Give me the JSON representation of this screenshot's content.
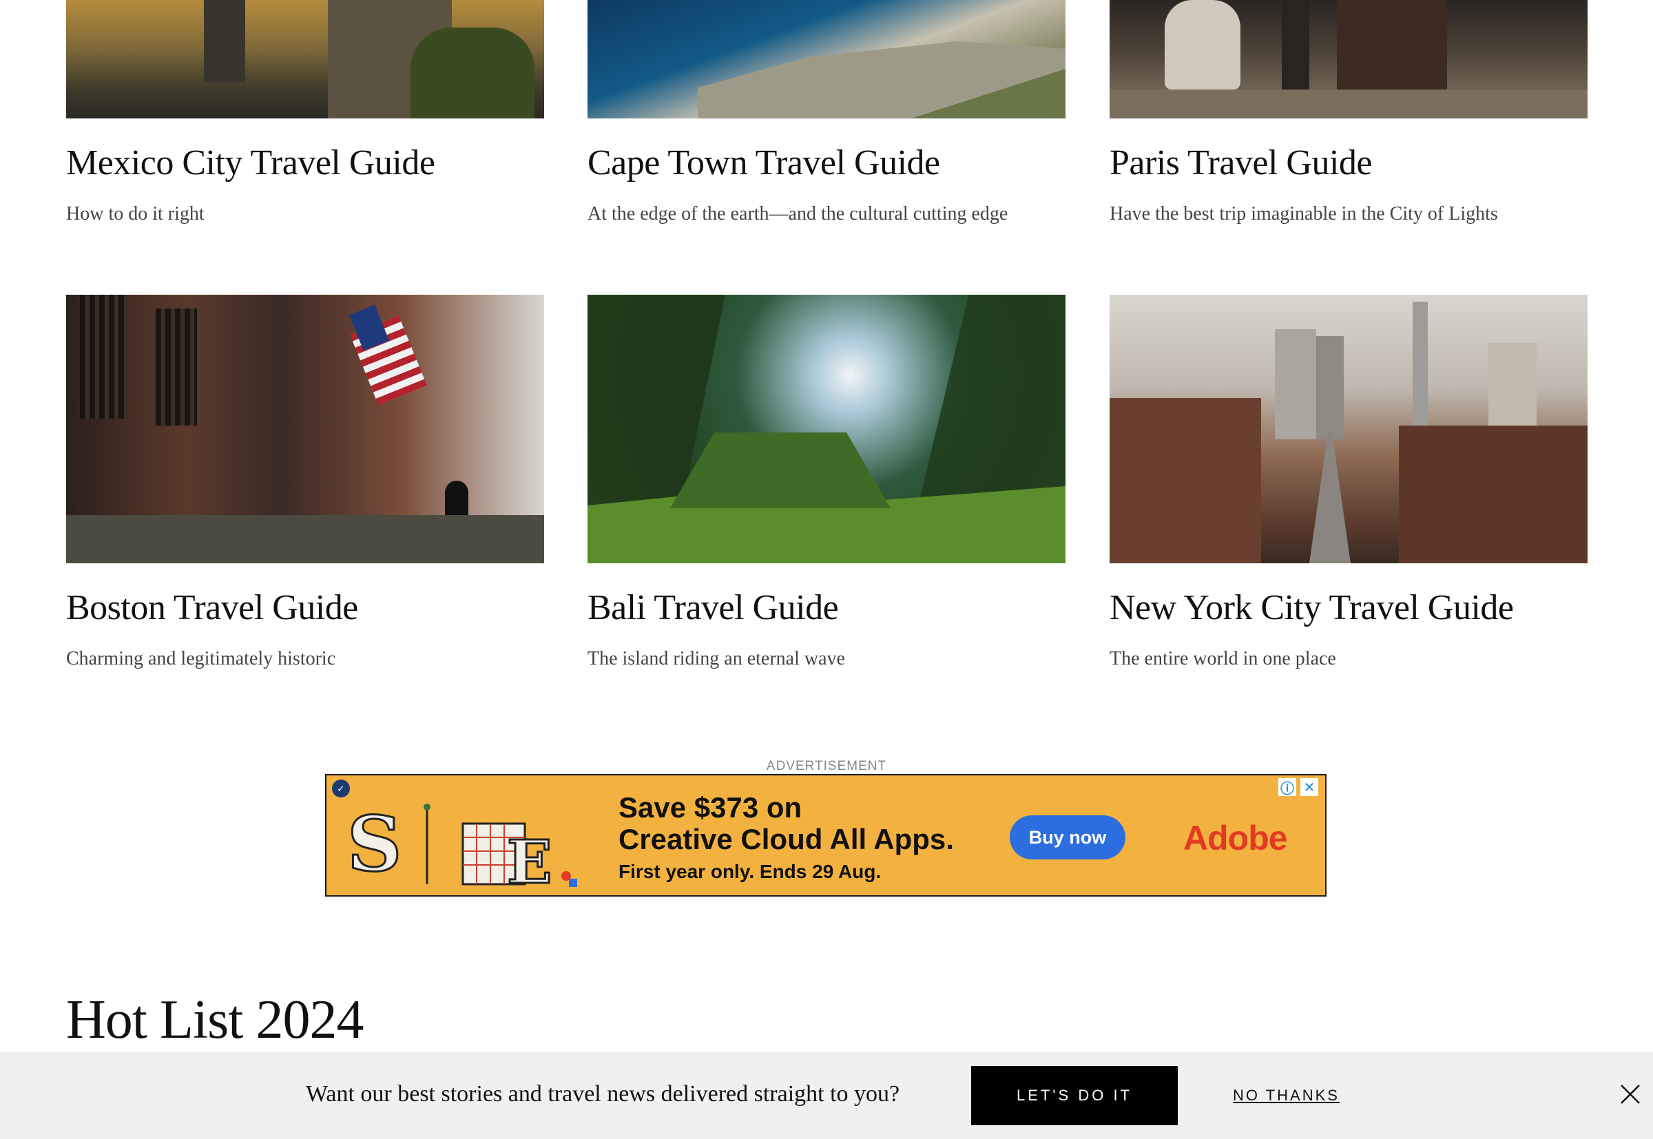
{
  "guides": [
    {
      "title": "Mexico City Travel Guide",
      "subtitle": "How to do it right"
    },
    {
      "title": "Cape Town Travel Guide",
      "subtitle": "At the edge of the earth—and the cultural cutting edge"
    },
    {
      "title": "Paris Travel Guide",
      "subtitle": "Have the best trip imaginable in the City of Lights"
    },
    {
      "title": "Boston Travel Guide",
      "subtitle": "Charming and legitimately historic"
    },
    {
      "title": "Bali Travel Guide",
      "subtitle": "The island riding an eternal wave"
    },
    {
      "title": "New York City Travel Guide",
      "subtitle": "The entire world in one place"
    }
  ],
  "ad": {
    "label": "ADVERTISEMENT",
    "headline_line1": "Save $373 on",
    "headline_line2": "Creative Cloud All Apps.",
    "subline": "First year only. Ends 29 Aug.",
    "button": "Buy now",
    "brand": "Adobe",
    "accent": "#f3b23f",
    "button_color": "#2c6ee0",
    "brand_color": "#e23b25"
  },
  "section": {
    "title": "Hot List 2024"
  },
  "newsletter": {
    "message": "Want our best stories and travel news delivered straight to you?",
    "cta": "LET'S DO IT",
    "decline": "NO THANKS"
  }
}
